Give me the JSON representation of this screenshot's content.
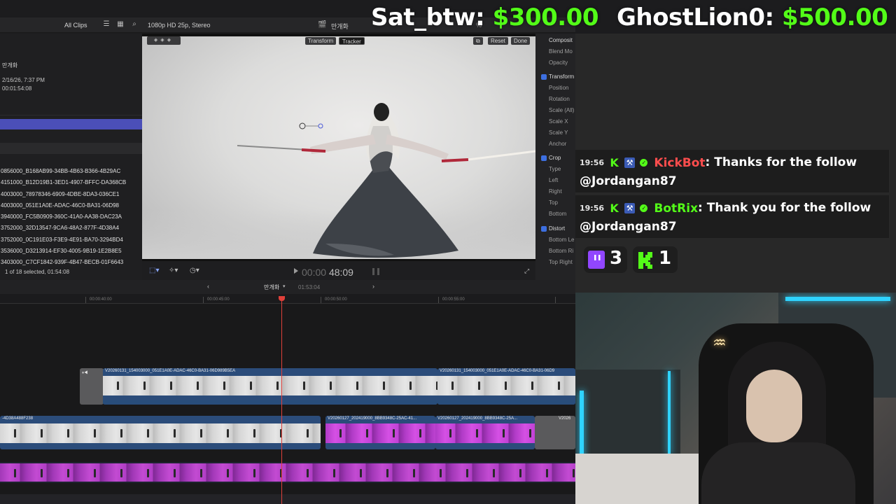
{
  "editor": {
    "topbar": {
      "all_clips": "All Clips",
      "format": "1080p HD 25p, Stereo",
      "project": "만개화",
      "zoom": "%"
    },
    "browser": {
      "clip_name": "만개화",
      "clip_date": "2/16/26, 7:37 PM",
      "clip_duration": "00:01:54:08",
      "items": [
        "0856000_B168AB99-34BB-4B63-B366-4B29AC",
        "4151000_B12D19B1-3ED1-4907-BFFC-DA368CB",
        "4003000_78978346-6909-4DBE-8DA3-036CE1",
        "4003000_051E1A0E-ADAC-46C0-BA31-06D98",
        "3940000_FC5B0909-360C-41A0-AA38-DAC23A",
        "3752000_32D13547-9CA6-48A2-877F-4D38A4",
        "3752000_0C191E03-F3E9-4E91-BA70-3294BD4",
        "3536000_D3213914-EF30-4005-9B19-1E2B8E5",
        "3403000_C7CF1842-939F-4B47-BECB-01F6643"
      ],
      "status": "1 of 18 selected, 01:54:08"
    },
    "viewer": {
      "transform_label": "Transform",
      "tracker_label": "Tracker",
      "reset_label": "Reset",
      "done_label": "Done"
    },
    "inspector": {
      "rows": [
        {
          "label": "Composit",
          "header": true,
          "check": false
        },
        {
          "label": "Blend Mo",
          "header": false,
          "check": false
        },
        {
          "label": "Opacity",
          "header": false,
          "check": false
        },
        {
          "label": "Transform",
          "header": true,
          "check": true
        },
        {
          "label": "Position",
          "header": false,
          "check": false
        },
        {
          "label": "Rotation",
          "header": false,
          "check": false
        },
        {
          "label": "Scale (All)",
          "header": false,
          "check": false
        },
        {
          "label": "Scale X",
          "header": false,
          "check": false
        },
        {
          "label": "Scale Y",
          "header": false,
          "check": false
        },
        {
          "label": "Anchor",
          "header": false,
          "check": false
        },
        {
          "label": "Crop",
          "header": true,
          "check": true
        },
        {
          "label": "Type",
          "header": false,
          "check": false
        },
        {
          "label": "Left",
          "header": false,
          "check": false
        },
        {
          "label": "Right",
          "header": false,
          "check": false
        },
        {
          "label": "Top",
          "header": false,
          "check": false
        },
        {
          "label": "Bottom",
          "header": false,
          "check": false
        },
        {
          "label": "Distort",
          "header": true,
          "check": true
        },
        {
          "label": "Bottom Le",
          "header": false,
          "check": false
        },
        {
          "label": "Bottom Ri",
          "header": false,
          "check": false
        },
        {
          "label": "Top Right",
          "header": false,
          "check": false
        }
      ]
    },
    "playback": {
      "timecode_dim": "00:00",
      "timecode": "48:09"
    },
    "timeline": {
      "project_name": "만개화",
      "project_duration": "01:53:04",
      "ruler": [
        "00:00:40:00",
        "00:00:45:00",
        "00:00:50:00",
        "00:00:55:00"
      ],
      "clips": {
        "primary_a": "V20260131_154003000_051E1A0E-ADAC-46C0-BA31-06D989B5EA",
        "primary_b": "V20260131_154003000_051E1A0E-ADAC-46C0-BA31-06D9",
        "lower_a": "-4D38A488F238",
        "lower_b": "V20260127_202419000_8BB9348C-25AC-41...",
        "lower_c": "V20260127_202419000_8BB9348C-25A...",
        "lower_d": "V2026"
      }
    }
  },
  "overlay": {
    "donations": [
      {
        "user": "Sat_btw:",
        "amount": "$300.00"
      },
      {
        "user": "GhostLion0:",
        "amount": "$500.00"
      }
    ],
    "chat": [
      {
        "time": "19:56",
        "user": "KickBot",
        "user_color": "#ff4d4d",
        "text": ": Thanks for the follow",
        "text2": "@Jordangan87"
      },
      {
        "time": "19:56",
        "user": "BotRix",
        "user_color": "#53fc18",
        "text": ": Thank you for the follow",
        "text2": "@Jordangan87"
      }
    ],
    "viewers": {
      "twitch": "3",
      "kick": "1"
    },
    "colors": {
      "kick_green": "#53fc18",
      "twitch_purple": "#9146ff"
    }
  }
}
